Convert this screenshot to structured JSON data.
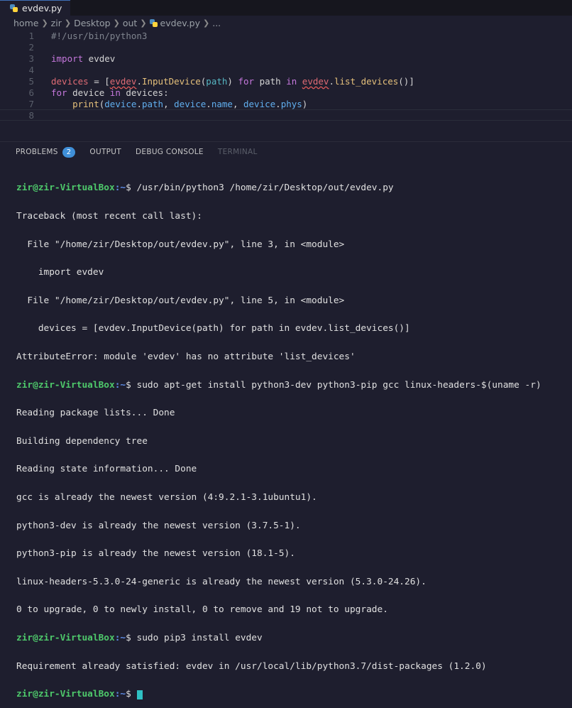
{
  "tab": {
    "filename": "evdev.py",
    "icon": "python-file-icon"
  },
  "breadcrumb": {
    "parts": [
      "home",
      "zir",
      "Desktop",
      "out"
    ],
    "file": "evdev.py",
    "more": "..."
  },
  "editor": {
    "line_numbers": [
      "1",
      "2",
      "3",
      "4",
      "5",
      "6",
      "7",
      "8"
    ],
    "lines": {
      "l1": "#!/usr/bin/python3",
      "l3_kw": "import",
      "l3_mod": " evdev",
      "l5_a": "devices",
      "l5_b": " = [",
      "l5_c": "evdev",
      "l5_d": ".",
      "l5_e": "InputDevice",
      "l5_f": "(",
      "l5_g": "path",
      "l5_h": ") ",
      "l5_i": "for",
      "l5_j": " path ",
      "l5_k": "in",
      "l5_l": " ",
      "l5_m": "evdev",
      "l5_n": ".",
      "l5_o": "list_devices",
      "l5_p": "()]",
      "l6_a": "for",
      "l6_b": " device ",
      "l6_c": "in",
      "l6_d": " devices:",
      "l7_a": "    ",
      "l7_b": "print",
      "l7_c": "(",
      "l7_d": "device",
      "l7_e": ".",
      "l7_f": "path",
      "l7_g": ", ",
      "l7_h": "device",
      "l7_i": ".",
      "l7_j": "name",
      "l7_k": ", ",
      "l7_l": "device",
      "l7_m": ".",
      "l7_n": "phys",
      "l7_o": ")"
    }
  },
  "panel": {
    "problems_label": "PROBLEMS",
    "problems_count": "2",
    "output_label": "OUTPUT",
    "debug_label": "DEBUG CONSOLE",
    "terminal_label": "TERMINAL"
  },
  "terminal": {
    "prompt_user": "zir@zir-VirtualBox",
    "prompt_path": ":~",
    "cmd1": "$ /usr/bin/python3 /home/zir/Desktop/out/evdev.py",
    "out1": [
      "Traceback (most recent call last):",
      "  File \"/home/zir/Desktop/out/evdev.py\", line 3, in <module>",
      "    import evdev",
      "  File \"/home/zir/Desktop/out/evdev.py\", line 5, in <module>",
      "    devices = [evdev.InputDevice(path) for path in evdev.list_devices()]",
      "AttributeError: module 'evdev' has no attribute 'list_devices'"
    ],
    "cmd2": "$ sudo apt-get install python3-dev python3-pip gcc linux-headers-$(uname -r)",
    "out2": [
      "Reading package lists... Done",
      "Building dependency tree",
      "Reading state information... Done",
      "gcc is already the newest version (4:9.2.1-3.1ubuntu1).",
      "python3-dev is already the newest version (3.7.5-1).",
      "python3-pip is already the newest version (18.1-5).",
      "linux-headers-5.3.0-24-generic is already the newest version (5.3.0-24.26).",
      "0 to upgrade, 0 to newly install, 0 to remove and 19 not to upgrade."
    ],
    "cmd3": "$ sudo pip3 install evdev",
    "out3": [
      "Requirement already satisfied: evdev in /usr/local/lib/python3.7/dist-packages (1.2.0)"
    ],
    "cmd4": "$ "
  },
  "colors": {
    "background": "#1e1e2e",
    "prompt_user": "#4ec96b",
    "prompt_path": "#5e8ee8",
    "cursor": "#2fc1c4",
    "badge": "#3f8fd8"
  }
}
